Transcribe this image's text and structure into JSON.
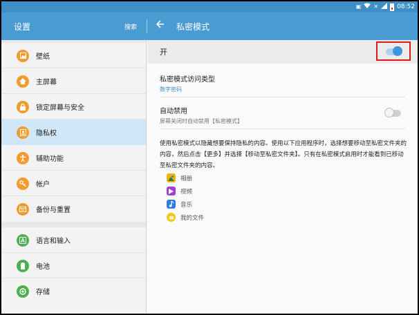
{
  "status_bar": {
    "time": "08:52",
    "icons": [
      "image-icon",
      "wifi-icon",
      "mute-icon",
      "signal-icon",
      "battery-icon"
    ]
  },
  "left_panel": {
    "title": "设置",
    "search_label": "搜索",
    "groups": [
      [
        {
          "label": "壁纸",
          "icon": "wallpaper-icon",
          "color": "#f29b2f"
        },
        {
          "label": "主屏幕",
          "icon": "home-icon",
          "color": "#f29b2f"
        },
        {
          "label": "锁定屏幕与安全",
          "icon": "lock-icon",
          "color": "#f29b2f"
        },
        {
          "label": "隐私权",
          "icon": "privacy-icon",
          "color": "#f29b2f",
          "selected": true
        },
        {
          "label": "辅助功能",
          "icon": "accessibility-icon",
          "color": "#f29b2f"
        },
        {
          "label": "帐户",
          "icon": "key-icon",
          "color": "#f29b2f"
        },
        {
          "label": "备份与重置",
          "icon": "backup-icon",
          "color": "#f29b2f"
        }
      ],
      [
        {
          "label": "语言和输入",
          "icon": "language-icon",
          "color": "#4caf50"
        },
        {
          "label": "电池",
          "icon": "battery-icon",
          "color": "#4caf50"
        },
        {
          "label": "存储",
          "icon": "storage-icon",
          "color": "#4caf50"
        }
      ]
    ]
  },
  "right_panel": {
    "title": "私密模式",
    "on_label": "开",
    "on_toggle": true,
    "access_type": {
      "title": "私密模式访问类型",
      "value": "数字密码"
    },
    "auto_disable": {
      "title": "自动禁用",
      "subtitle": "屏幕关闭时自动禁用【私密模式】",
      "toggle": false
    },
    "description": "使用私密模式以隐藏想要保持隐私的内容。使用以下应用程序时，选择想要移动至私密文件夹的内容，然后点击【更多】并选择【移动至私密文件夹】。只有在私密模式启用时才能看到已移动至私密文件夹的内容。",
    "apps": [
      {
        "label": "相册",
        "icon": "gallery-icon",
        "color": "#f4b400"
      },
      {
        "label": "视频",
        "icon": "video-icon",
        "color": "#a23fd1"
      },
      {
        "label": "音乐",
        "icon": "music-icon",
        "color": "#2a7de1"
      },
      {
        "label": "我的文件",
        "icon": "my-files-icon",
        "color": "#f5c518"
      }
    ]
  },
  "colors": {
    "accent": "#4a9bd1",
    "highlight": "#e01818"
  }
}
